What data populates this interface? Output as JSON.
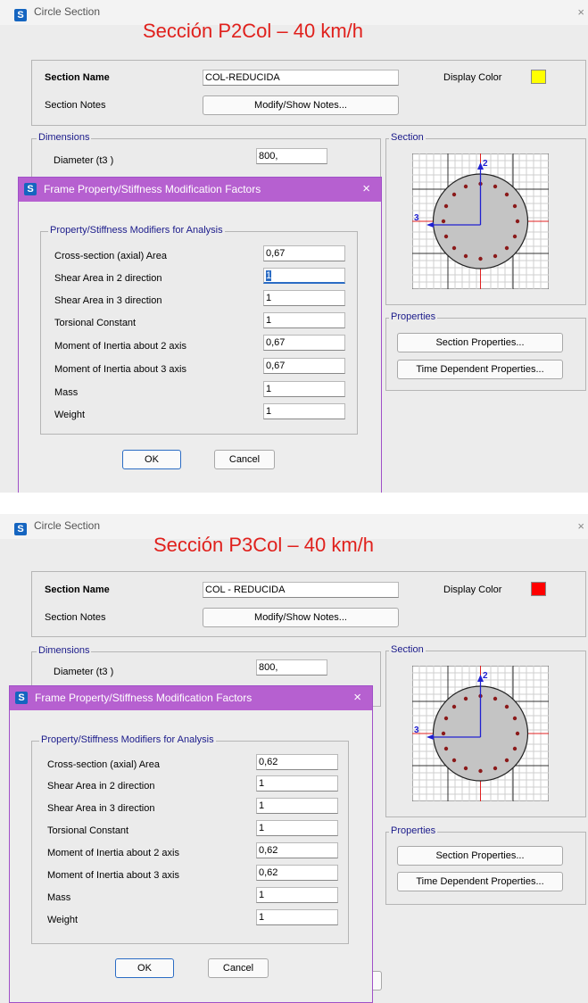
{
  "colors": {
    "annotation_red": "#e0201c",
    "dialog_titlebar": "#b660d0",
    "group_label": "#1a1a8a"
  },
  "panels": [
    {
      "window_title": "Circle Section",
      "close_glyph": "×",
      "big_title": "Sección P2Col – 40 km/h",
      "section_name_label": "Section Name",
      "section_name_value": "COL-REDUCIDA",
      "display_color_label": "Display Color",
      "display_color": "#ffff00",
      "section_notes_label": "Section Notes",
      "notes_button": "Modify/Show Notes...",
      "dimensions_label": "Dimensions",
      "diameter_label": "Diameter  (t3 )",
      "diameter_value": "800,",
      "section_label": "Section",
      "axis_2": "2",
      "axis_3": "3",
      "properties_label": "Properties",
      "section_properties_button": "Section Properties...",
      "time_dependent_button": "Time Dependent Properties...",
      "dialog": {
        "title": "Frame Property/Stiffness Modification Factors",
        "close_glyph": "×",
        "group_label": "Property/Stiffness Modifiers for Analysis",
        "rows": [
          {
            "label": "Cross-section (axial) Area",
            "value": "0,67"
          },
          {
            "label": "Shear Area in 2 direction",
            "value": "1"
          },
          {
            "label": "Shear Area in 3 direction",
            "value": "1"
          },
          {
            "label": "Torsional Constant",
            "value": "1"
          },
          {
            "label": "Moment of Inertia about 2 axis",
            "value": "0,67"
          },
          {
            "label": "Moment of Inertia about 3 axis",
            "value": "0,67"
          },
          {
            "label": "Mass",
            "value": "1"
          },
          {
            "label": "Weight",
            "value": "1"
          }
        ],
        "ok_button": "OK",
        "cancel_button": "Cancel"
      }
    },
    {
      "window_title": "Circle Section",
      "close_glyph": "×",
      "big_title": "Sección P3Col – 40 km/h",
      "section_name_label": "Section Name",
      "section_name_value": "COL - REDUCIDA",
      "display_color_label": "Display Color",
      "display_color": "#ff0000",
      "section_notes_label": "Section Notes",
      "notes_button": "Modify/Show Notes...",
      "dimensions_label": "Dimensions",
      "diameter_label": "Diameter  (t3 )",
      "diameter_value": "800,",
      "section_label": "Section",
      "axis_2": "2",
      "axis_3": "3",
      "properties_label": "Properties",
      "section_properties_button": "Section Properties...",
      "time_dependent_button": "Time Dependent Properties...",
      "dialog": {
        "title": "Frame Property/Stiffness Modification Factors",
        "close_glyph": "×",
        "group_label": "Property/Stiffness Modifiers for Analysis",
        "rows": [
          {
            "label": "Cross-section (axial) Area",
            "value": "0,62"
          },
          {
            "label": "Shear Area in 2 direction",
            "value": "1"
          },
          {
            "label": "Shear Area in 3 direction",
            "value": "1"
          },
          {
            "label": "Torsional Constant",
            "value": "1"
          },
          {
            "label": "Moment of Inertia about 2 axis",
            "value": "0,62"
          },
          {
            "label": "Moment of Inertia about 3 axis",
            "value": "0,62"
          },
          {
            "label": "Mass",
            "value": "1"
          },
          {
            "label": "Weight",
            "value": "1"
          }
        ],
        "ok_button": "OK",
        "cancel_button": "Cancel"
      }
    }
  ]
}
